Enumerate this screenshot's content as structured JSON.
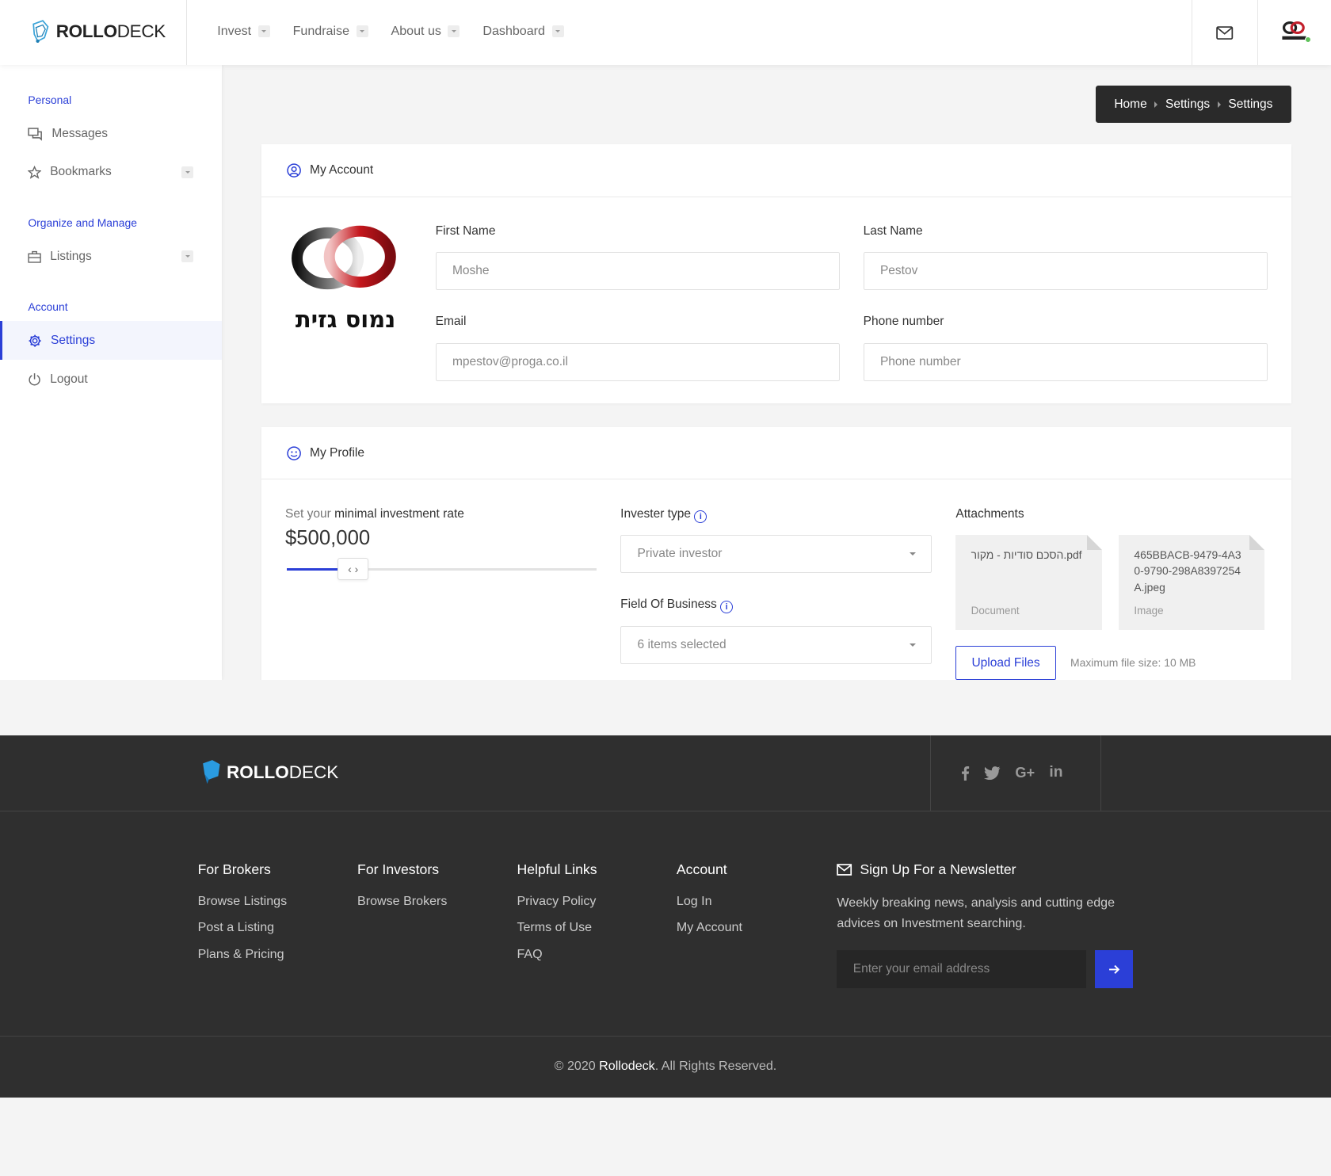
{
  "brand": {
    "name_bold": "ROLLO",
    "name_light": "DECK"
  },
  "nav": [
    {
      "label": "Invest"
    },
    {
      "label": "Fundraise"
    },
    {
      "label": "About us"
    },
    {
      "label": "Dashboard"
    }
  ],
  "sidebar": {
    "sections": [
      "Personal",
      "Organize and Manage",
      "Account"
    ],
    "items": [
      {
        "label": "Messages",
        "icon": "chat-icon"
      },
      {
        "label": "Bookmarks",
        "icon": "star-icon"
      },
      {
        "label": "Listings",
        "icon": "briefcase-icon"
      },
      {
        "label": "Settings",
        "icon": "gear-icon"
      },
      {
        "label": "Logout",
        "icon": "power-icon"
      }
    ]
  },
  "breadcrumb": [
    "Home",
    "Settings",
    "Settings"
  ],
  "account": {
    "title": "My Account",
    "company_logo_text": "נמוס גזית",
    "first_name_label": "First Name",
    "first_name": "Moshe",
    "last_name_label": "Last Name",
    "last_name": "Pestov",
    "email_label": "Email",
    "email": "mpestov@proga.co.il",
    "phone_label": "Phone number",
    "phone_placeholder": "Phone number"
  },
  "profile": {
    "title": "My Profile",
    "rate_prefix": "Set your ",
    "rate_strong": "minimal investment rate",
    "rate_value": "$500,000",
    "rate_fraction": 0.21,
    "invester_type_label": "Invester type",
    "invester_type": "Private investor",
    "field_label": "Field Of Business",
    "field_value": "6 items selected",
    "attachments_label": "Attachments",
    "attachments": [
      {
        "name": "הסכם סודיות - מקור.pdf",
        "type": "Document"
      },
      {
        "name": "465BBACB-9479-4A30-9790-298A8397254A.jpeg",
        "type": "Image"
      }
    ],
    "upload_label": "Upload Files",
    "max_size": "Maximum file size: 10 MB"
  },
  "footer": {
    "social": [
      "facebook-icon",
      "twitter-icon",
      "google-plus-icon",
      "linkedin-icon"
    ],
    "columns": [
      {
        "title": "For Brokers",
        "links": [
          "Browse Listings",
          "Post a Listing",
          "Plans & Pricing"
        ]
      },
      {
        "title": "For Investors",
        "links": [
          "Browse Brokers"
        ]
      },
      {
        "title": "Helpful Links",
        "links": [
          "Privacy Policy",
          "Terms of Use",
          "FAQ"
        ]
      },
      {
        "title": "Account",
        "links": [
          "Log In",
          "My Account"
        ]
      }
    ],
    "newsletter_title": "Sign Up For a Newsletter",
    "newsletter_text": "Weekly breaking news, analysis and cutting edge advices on Investment searching.",
    "newsletter_placeholder": "Enter your email address",
    "copyright_prefix": "© 2020 ",
    "copyright_brand": "Rollodeck",
    "copyright_suffix": ". All Rights Reserved."
  },
  "colors": {
    "accent": "#2b3fd7",
    "footer_bg": "#2f2f2f",
    "crumb_bg": "#2a2a2a"
  }
}
